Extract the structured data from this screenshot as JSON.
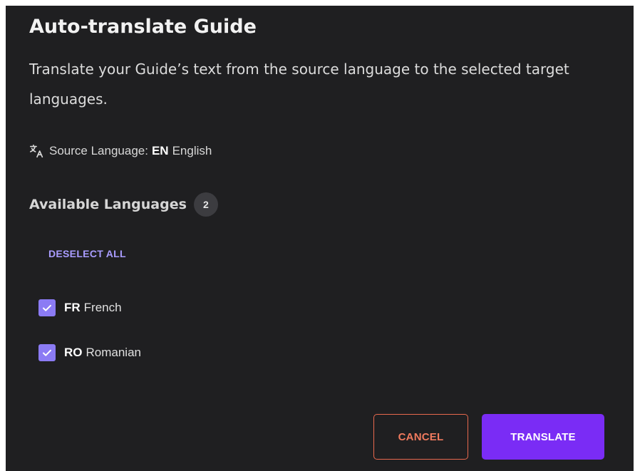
{
  "dialog": {
    "title": "Auto-translate Guide",
    "description": "Translate your Guide’s text from the source language to the selected target languages."
  },
  "source": {
    "label": "Source Language:",
    "code": "EN",
    "name": "English",
    "icon": "translate-icon"
  },
  "available": {
    "label": "Available Languages",
    "count": "2",
    "deselect_all": "DESELECT ALL"
  },
  "languages": [
    {
      "code": "FR",
      "name": "French",
      "checked": true
    },
    {
      "code": "RO",
      "name": "Romanian",
      "checked": true
    }
  ],
  "actions": {
    "cancel": "CANCEL",
    "translate": "TRANSLATE"
  },
  "colors": {
    "background": "#1f1f21",
    "accent": "#7a2cf5",
    "checkbox": "#8b7bf4",
    "link": "#a99cff",
    "cancel": "#f07a5e"
  }
}
